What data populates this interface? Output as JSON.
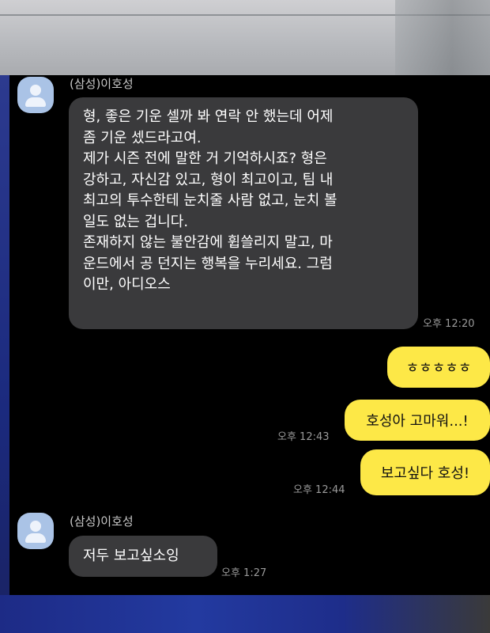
{
  "messages": [
    {
      "sender": "(삼성)이호성",
      "lines": [
        "형, 좋은 기운 셀까 봐 연락 안 했는데 어제",
        "좀 기운 셌드라고여.",
        "제가 시즌 전에 말한 거 기억하시죠? 형은",
        "강하고, 자신감 있고, 형이 최고이고, 팀 내",
        "최고의 투수한테 눈치줄 사람 없고, 눈치 볼",
        "일도 없는 겁니다.",
        "존재하지 않는 불안감에 휩쓸리지 말고, 마",
        "운드에서 공 던지는 행복을 누리세요. 그럼",
        "이만, 아디오스"
      ],
      "time": "오후 12:20"
    },
    {
      "text": "ㅎㅎㅎㅎㅎ",
      "time": ""
    },
    {
      "text": "호성아 고마워...!",
      "time": "오후 12:43"
    },
    {
      "text": "보고싶다 호성!",
      "time": "오후 12:44"
    },
    {
      "sender": "(삼성)이호성",
      "text": "저두 보고싶소잉",
      "time": "오후 1:27"
    }
  ],
  "colors": {
    "background": "#000000",
    "incoming_bubble": "#3a3a3c",
    "outgoing_bubble": "#fde847",
    "avatar": "#aac3e6"
  },
  "icons": {
    "avatar": "default-profile-icon"
  }
}
